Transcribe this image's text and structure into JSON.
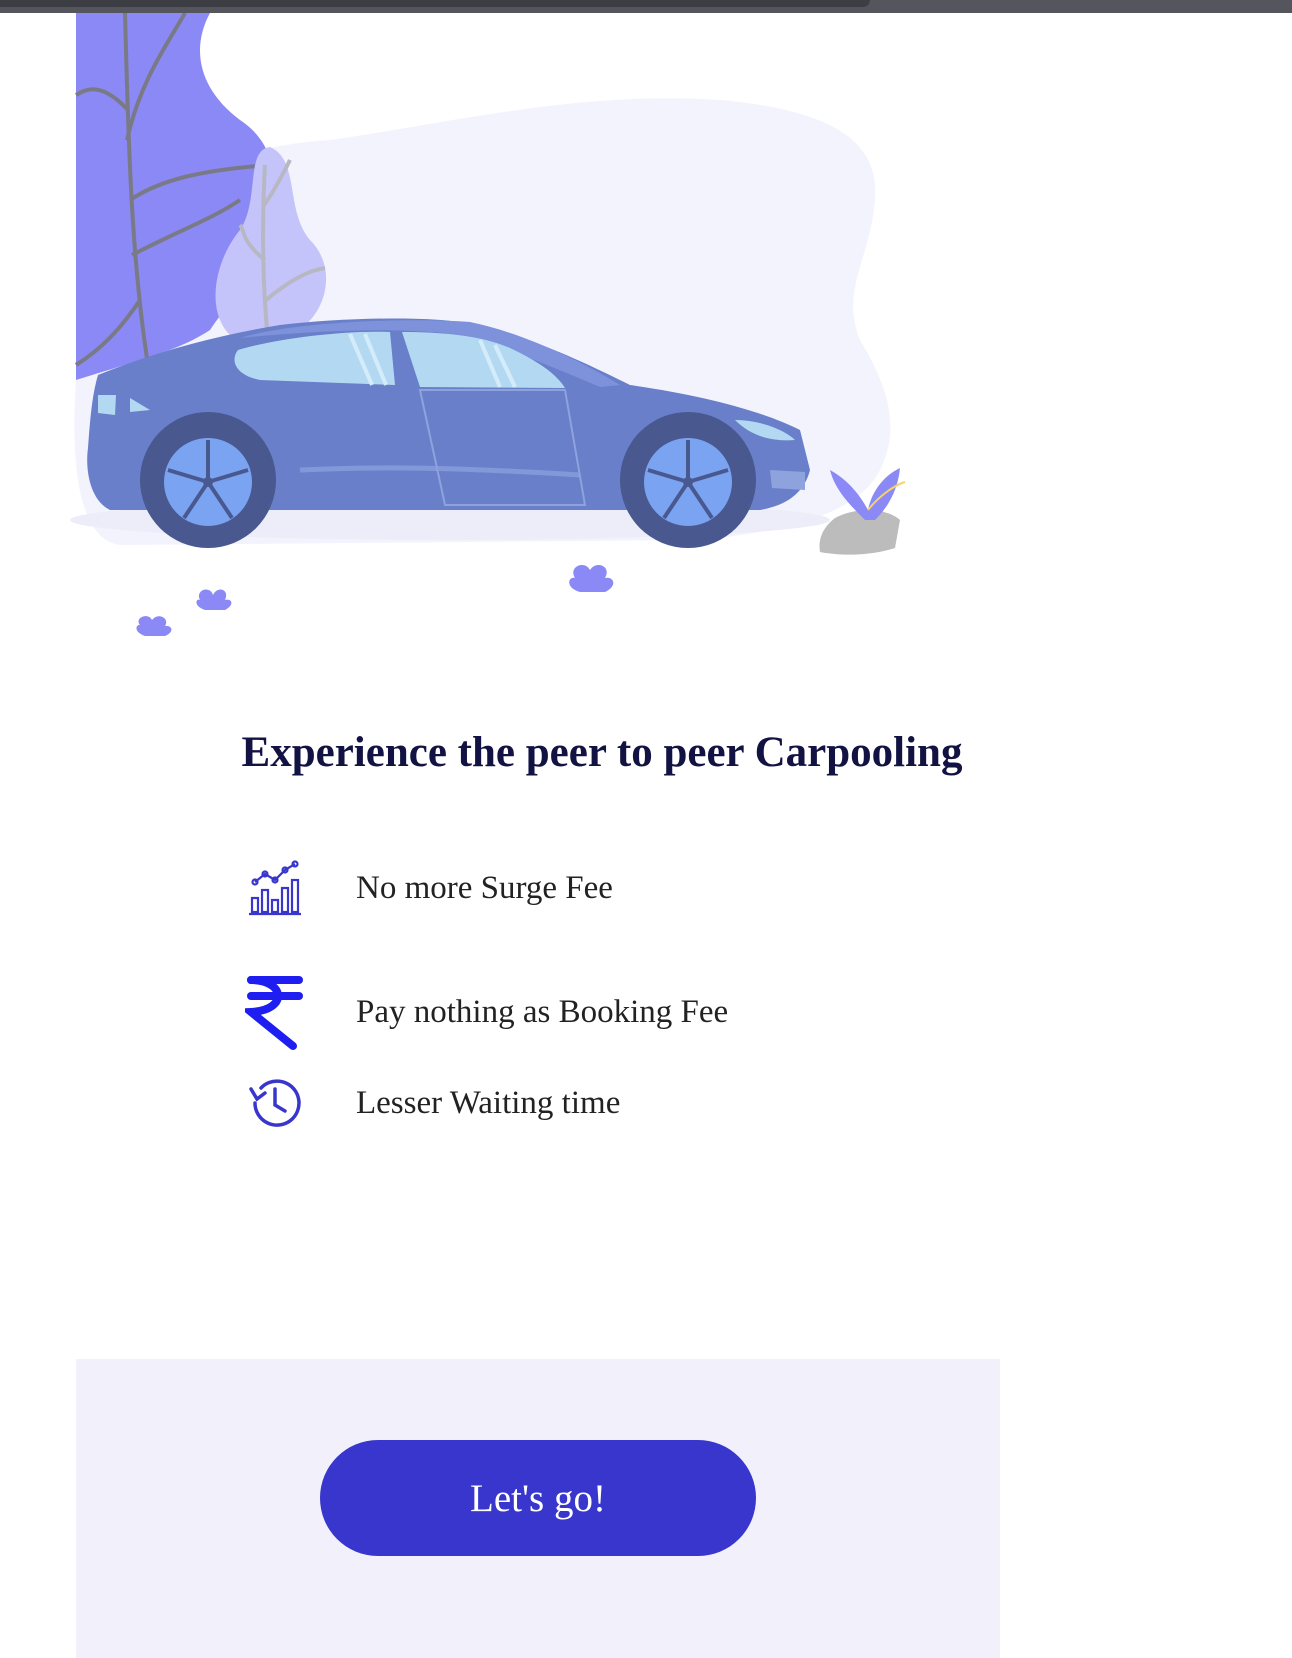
{
  "hero": {
    "illustration": "car-illustration"
  },
  "headline": "Experience the peer to peer Carpooling",
  "features": [
    {
      "icon": "chart-icon",
      "label": "No more Surge Fee"
    },
    {
      "icon": "rupee-icon",
      "label": "Pay nothing as Booking Fee"
    },
    {
      "icon": "clock-history-icon",
      "label": "Lesser Waiting time"
    }
  ],
  "cta": {
    "label": "Let's go!"
  },
  "colors": {
    "accent": "#3836cc",
    "headline": "#121342",
    "panel": "#f1f0fb",
    "plant": "#8b89f5",
    "car": "#6a7fca"
  }
}
